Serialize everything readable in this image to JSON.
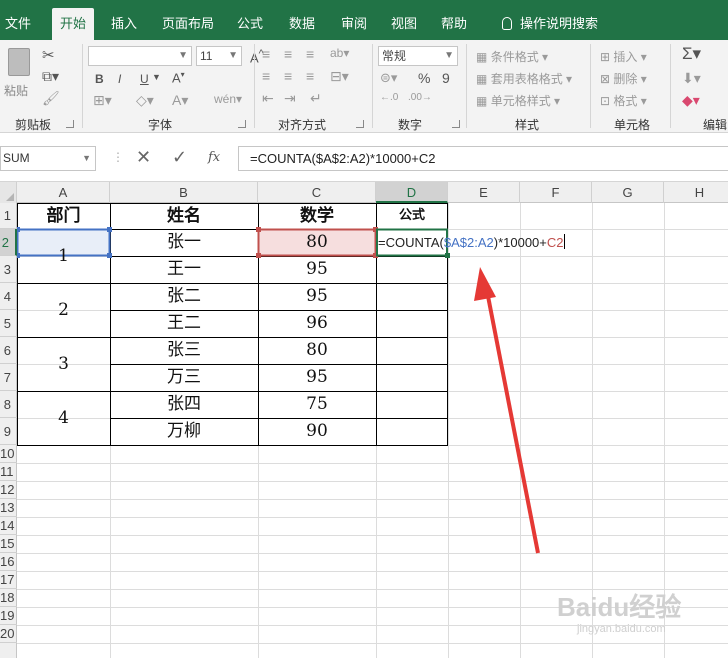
{
  "ribbon": {
    "tabs": [
      "文件",
      "开始",
      "插入",
      "页面布局",
      "公式",
      "数据",
      "审阅",
      "视图",
      "帮助"
    ],
    "search_label": "操作说明搜索",
    "clipboard": {
      "paste": "粘贴",
      "label": "剪贴板"
    },
    "font": {
      "name": "",
      "size": "11",
      "bold": "B",
      "italic": "I",
      "underline": "U",
      "label": "字体"
    },
    "align": {
      "label": "对齐方式"
    },
    "number": {
      "format": "常规",
      "percent": "%",
      "comma": "9",
      "label": "数字"
    },
    "styles": {
      "cond": "条件格式",
      "table": "套用表格格式",
      "cell": "单元格样式",
      "label": "样式"
    },
    "cells": {
      "insert": "插入",
      "delete": "删除",
      "format": "格式",
      "label": "单元格"
    },
    "editing": {
      "label": "编辑"
    }
  },
  "formula_bar": {
    "name_box": "SUM",
    "fx": "fx",
    "formula": "=COUNTA($A$2:A2)*10000+C2"
  },
  "sheet": {
    "columns": [
      "A",
      "B",
      "C",
      "D",
      "E",
      "F",
      "G",
      "H"
    ],
    "rows": [
      "1",
      "2",
      "3",
      "4",
      "5",
      "6",
      "7",
      "8",
      "9",
      "10",
      "11",
      "12",
      "13",
      "14",
      "15",
      "16",
      "17",
      "18",
      "19",
      "20"
    ],
    "headers": {
      "a": "部门",
      "b": "姓名",
      "c": "数学",
      "d": "公式"
    },
    "departments": [
      "1",
      "2",
      "3",
      "4"
    ],
    "names": [
      "张一",
      "王一",
      "张二",
      "王二",
      "张三",
      "万三",
      "张四",
      "万柳"
    ],
    "scores": [
      "80",
      "95",
      "95",
      "96",
      "80",
      "95",
      "75",
      "90"
    ],
    "edit": {
      "prefix": "=COUNTA(",
      "ref1": "$A$2:A2",
      "mid": ")*10000+",
      "ref2": "C2"
    }
  },
  "watermark": {
    "brand": "Baidu经验",
    "url": "jingyan.baidu.com"
  },
  "colors": {
    "accent": "#217346",
    "ref_blue": "#4472c4",
    "ref_red": "#c0504d",
    "arrow": "#e53935"
  }
}
